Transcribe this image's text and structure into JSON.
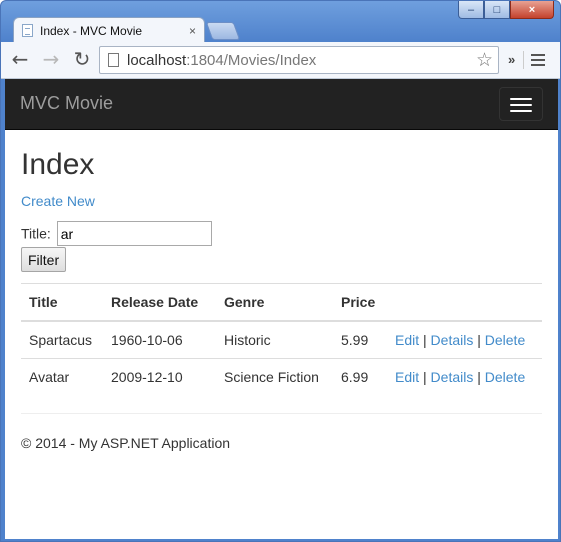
{
  "browser": {
    "tab_title": "Index - MVC Movie",
    "tab_close": "×",
    "url_host": "localhost",
    "url_rest": ":1804/Movies/Index",
    "extensions_label": "»",
    "window_controls": {
      "minimize": "–",
      "maximize": "□",
      "close": "×"
    }
  },
  "navbar": {
    "brand": "MVC Movie"
  },
  "page": {
    "heading": "Index",
    "create_link": "Create New",
    "filter": {
      "label": "Title:",
      "value": "ar",
      "button": "Filter"
    }
  },
  "table": {
    "headers": [
      "Title",
      "Release Date",
      "Genre",
      "Price"
    ],
    "rows": [
      {
        "title": "Spartacus",
        "release_date": "1960-10-06",
        "genre": "Historic",
        "price": "5.99"
      },
      {
        "title": "Avatar",
        "release_date": "2009-12-10",
        "genre": "Science Fiction",
        "price": "6.99"
      }
    ],
    "actions": {
      "edit": "Edit",
      "details": "Details",
      "delete": "Delete",
      "separator": "|"
    }
  },
  "footer": {
    "text": "© 2014 - My ASP.NET Application"
  },
  "colors": {
    "navbar": "#222222",
    "link": "#428bca",
    "brand": "#9d9d9d"
  },
  "icons": [
    "back-icon",
    "forward-icon",
    "reload-icon",
    "page-icon",
    "star-icon",
    "menu-icon",
    "hamburger-icon"
  ]
}
